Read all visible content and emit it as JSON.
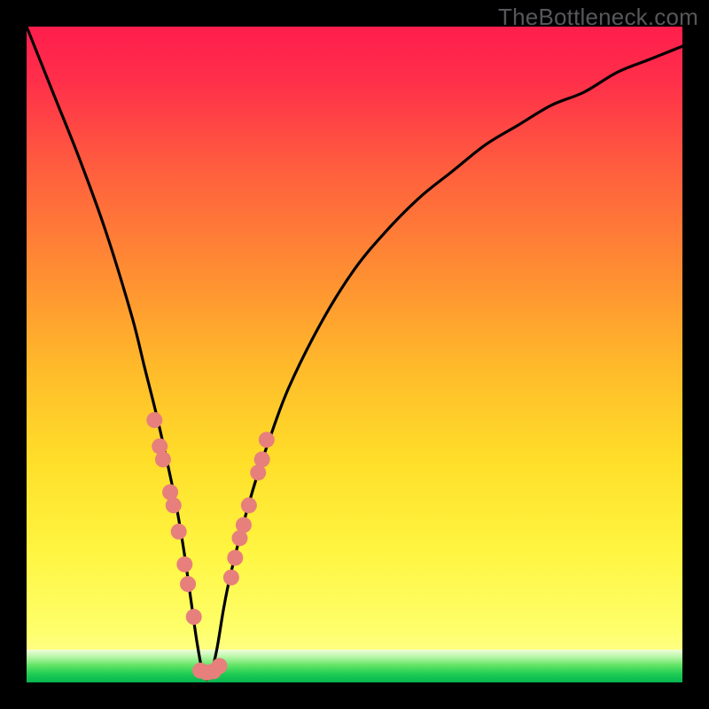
{
  "watermark": "TheBottleneck.com",
  "accent": {
    "curve": "#000000",
    "dots": "#e77f7c",
    "band_top": "#e8fbe5",
    "band_mid": "#5fe263",
    "band_bottom": "#06b64e"
  },
  "chart_data": {
    "type": "line",
    "title": "",
    "xlabel": "",
    "ylabel": "",
    "xlim": [
      0,
      100
    ],
    "ylim": [
      0,
      100
    ],
    "notes": "V-shaped bottleneck curve on rainbow gradient. Y is mismatch % (0=green bottom, 100=red top). Vertex ~x=27. Dots mark sample points near the valley.",
    "series": [
      {
        "name": "bottleneck-curve",
        "x": [
          0,
          4,
          8,
          12,
          16,
          18,
          20,
          22,
          23,
          24,
          25,
          26,
          27,
          28,
          29,
          30,
          31,
          33,
          35,
          37,
          40,
          45,
          50,
          55,
          60,
          65,
          70,
          75,
          80,
          85,
          90,
          95,
          100
        ],
        "y": [
          100,
          90,
          80,
          69,
          56,
          48,
          40,
          31,
          26,
          20,
          13,
          6,
          1,
          1,
          5,
          11,
          16,
          24,
          31,
          37,
          45,
          55,
          63,
          69,
          74,
          78,
          82,
          85,
          88,
          90,
          93,
          95,
          97
        ]
      },
      {
        "name": "dots-left",
        "x": [
          19.5,
          20.3,
          20.8,
          21.9,
          22.4,
          23.2,
          24.1,
          24.6,
          25.5
        ],
        "y": [
          40,
          36,
          34,
          29,
          27,
          23,
          18,
          15,
          10
        ]
      },
      {
        "name": "dots-right",
        "x": [
          31.2,
          31.8,
          32.5,
          33.1,
          33.9,
          35.3,
          35.9,
          36.6
        ],
        "y": [
          16,
          19,
          22,
          24,
          27,
          32,
          34,
          37
        ]
      },
      {
        "name": "dots-bottom",
        "x": [
          26.5,
          27.5,
          28.5,
          29.4
        ],
        "y": [
          1.8,
          1.5,
          1.7,
          2.5
        ]
      }
    ],
    "green_band": {
      "y_from": 0,
      "y_to": 5
    }
  }
}
